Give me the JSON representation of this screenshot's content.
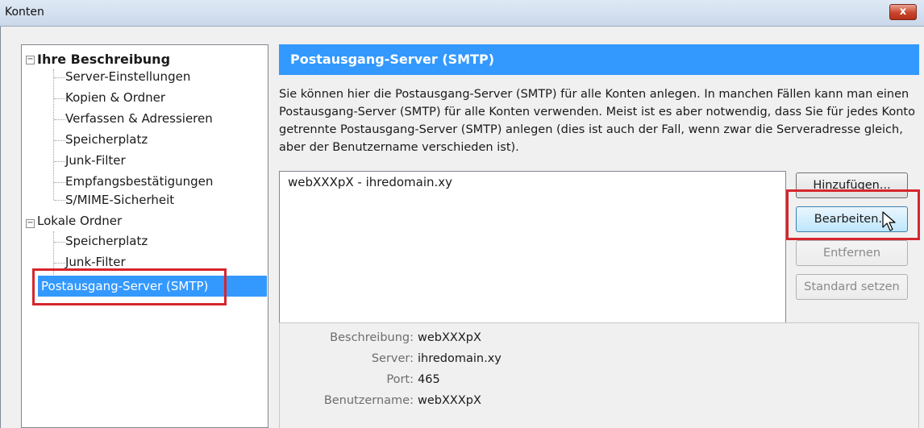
{
  "window": {
    "title": "Konten",
    "close_label": "x"
  },
  "tree": {
    "groups": [
      {
        "label": "Ihre Beschreibung",
        "children": [
          "Server-Einstellungen",
          "Kopien & Ordner",
          "Verfassen & Adressieren",
          "Speicherplatz",
          "Junk-Filter",
          "Empfangsbestätigungen",
          "S/MIME-Sicherheit"
        ]
      },
      {
        "label": "Lokale Ordner",
        "children": [
          "Speicherplatz",
          "Junk-Filter"
        ]
      }
    ],
    "selected": "Postausgang-Server (SMTP)",
    "expander_symbol": "−"
  },
  "main": {
    "header": "Postausgang-Server (SMTP)",
    "description": "Sie können hier die Postausgang-Server (SMTP) für alle Konten anlegen. In manchen Fällen kann man einen Postausgang-Server (SMTP) für alle Konten verwenden. Meist ist es aber notwendig, dass Sie für jedes Konto getrennte Postausgang-Server (SMTP) anlegen (dies ist auch der Fall, wenn zwar die Serveradresse gleich, aber der Benutzername verschieden ist).",
    "servers": [
      "webXXXpX - ihredomain.xy"
    ],
    "buttons": {
      "add": "Hinzufügen...",
      "edit": "Bearbeiten...",
      "remove": "Entfernen",
      "default": "Standard setzen"
    },
    "details": {
      "description_label": "Beschreibung:",
      "description_value": "webXXXpX",
      "server_label": "Server:",
      "server_value": "ihredomain.xy",
      "port_label": "Port:",
      "port_value": "465",
      "username_label": "Benutzername:",
      "username_value": "webXXXpX"
    }
  },
  "colors": {
    "accent": "#3399ff",
    "highlight": "#d6262d",
    "close": "#c8452c"
  }
}
